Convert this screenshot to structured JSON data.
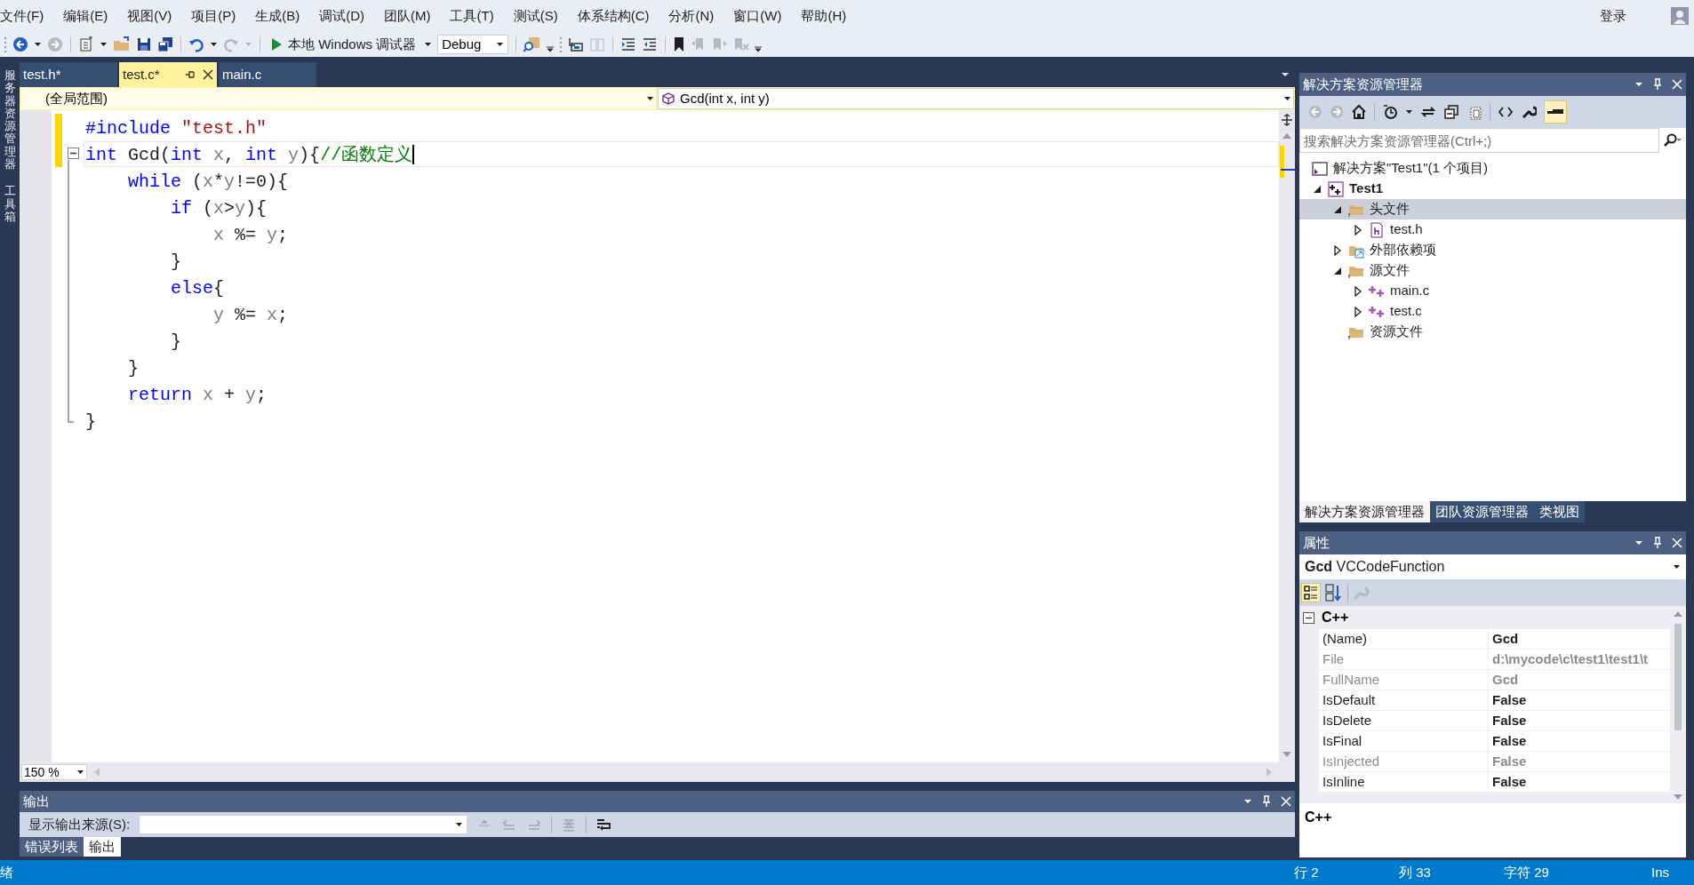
{
  "menu": [
    "文件(F)",
    "编辑(E)",
    "视图(V)",
    "项目(P)",
    "生成(B)",
    "调试(D)",
    "团队(M)",
    "工具(T)",
    "测试(S)",
    "体系结构(C)",
    "分析(N)",
    "窗口(W)",
    "帮助(H)"
  ],
  "login": "登录",
  "toolbar": {
    "debugger": "本地 Windows 调试器",
    "configuration": "Debug"
  },
  "left_rail": [
    "服务器资源管理器",
    "工具箱"
  ],
  "editor": {
    "tabs": [
      {
        "label": "test.h*",
        "selected": false
      },
      {
        "label": "test.c*",
        "selected": true
      },
      {
        "label": "main.c",
        "selected": false
      }
    ],
    "scope": "(全局范围)",
    "member": "Gcd(int x, int y)",
    "lines": [
      {
        "modified": true,
        "current": false,
        "collapsible": false,
        "tokens": [
          {
            "kind": "preproc",
            "text": "#include"
          },
          {
            "kind": "string",
            "text": " \"test.h\""
          }
        ]
      },
      {
        "modified": true,
        "current": true,
        "collapsible": true,
        "tokens": [
          {
            "kind": "keyword",
            "text": "int"
          },
          {
            "kind": "plain",
            "text": " Gcd("
          },
          {
            "kind": "keyword",
            "text": "int"
          },
          {
            "kind": "var",
            "text": " x"
          },
          {
            "kind": "plain",
            "text": ", "
          },
          {
            "kind": "keyword",
            "text": "int"
          },
          {
            "kind": "var",
            "text": " y"
          },
          {
            "kind": "plain",
            "text": "){"
          },
          {
            "kind": "comment",
            "text": "//函数定义"
          }
        ]
      },
      {
        "modified": false,
        "current": false,
        "collapsible": false,
        "tokens": [
          {
            "kind": "keyword",
            "text": "    while"
          },
          {
            "kind": "plain",
            "text": " ("
          },
          {
            "kind": "var",
            "text": "x"
          },
          {
            "kind": "plain",
            "text": "*"
          },
          {
            "kind": "var",
            "text": "y"
          },
          {
            "kind": "plain",
            "text": "!=0){"
          }
        ]
      },
      {
        "modified": false,
        "current": false,
        "collapsible": false,
        "tokens": [
          {
            "kind": "keyword",
            "text": "        if"
          },
          {
            "kind": "plain",
            "text": " ("
          },
          {
            "kind": "var",
            "text": "x"
          },
          {
            "kind": "plain",
            "text": ">"
          },
          {
            "kind": "var",
            "text": "y"
          },
          {
            "kind": "plain",
            "text": "){"
          }
        ]
      },
      {
        "modified": false,
        "current": false,
        "collapsible": false,
        "tokens": [
          {
            "kind": "var",
            "text": "            x"
          },
          {
            "kind": "plain",
            "text": " %= "
          },
          {
            "kind": "var",
            "text": "y"
          },
          {
            "kind": "plain",
            "text": ";"
          }
        ]
      },
      {
        "modified": false,
        "current": false,
        "collapsible": false,
        "tokens": [
          {
            "kind": "plain",
            "text": "        }"
          }
        ]
      },
      {
        "modified": false,
        "current": false,
        "collapsible": false,
        "tokens": [
          {
            "kind": "keyword",
            "text": "        else"
          },
          {
            "kind": "plain",
            "text": "{"
          }
        ]
      },
      {
        "modified": false,
        "current": false,
        "collapsible": false,
        "tokens": [
          {
            "kind": "var",
            "text": "            y"
          },
          {
            "kind": "plain",
            "text": " %= "
          },
          {
            "kind": "var",
            "text": "x"
          },
          {
            "kind": "plain",
            "text": ";"
          }
        ]
      },
      {
        "modified": false,
        "current": false,
        "collapsible": false,
        "tokens": [
          {
            "kind": "plain",
            "text": "        }"
          }
        ]
      },
      {
        "modified": false,
        "current": false,
        "collapsible": false,
        "tokens": [
          {
            "kind": "plain",
            "text": "    }"
          }
        ]
      },
      {
        "modified": false,
        "current": false,
        "collapsible": false,
        "tokens": [
          {
            "kind": "keyword",
            "text": "    return"
          },
          {
            "kind": "var",
            "text": " x"
          },
          {
            "kind": "plain",
            "text": " + "
          },
          {
            "kind": "var",
            "text": "y"
          },
          {
            "kind": "plain",
            "text": ";"
          }
        ]
      },
      {
        "modified": false,
        "current": false,
        "collapsible": false,
        "tokens": [
          {
            "kind": "plain",
            "text": "}"
          }
        ]
      }
    ],
    "zoom": "150 %"
  },
  "output": {
    "title": "输出",
    "source_label": "显示输出来源(S):",
    "tabs": [
      {
        "label": "错误列表",
        "selected": false
      },
      {
        "label": "输出",
        "selected": true
      }
    ]
  },
  "solution_explorer": {
    "title": "解决方案资源管理器",
    "search_placeholder": "搜索解决方案资源管理器(Ctrl+;)",
    "tree": [
      {
        "kind": "solution",
        "label": "解决方案\"Test1\"(1 个项目)",
        "selected": false,
        "children": [
          {
            "kind": "project",
            "label": "Test1",
            "expanded": true,
            "selected": false,
            "children": [
              {
                "kind": "folder",
                "label": "头文件",
                "expanded": true,
                "selected": true,
                "children": [
                  {
                    "kind": "header",
                    "label": "test.h",
                    "expanded": false,
                    "selected": false
                  }
                ]
              },
              {
                "kind": "deps",
                "label": "外部依赖项",
                "expanded": false,
                "selected": false
              },
              {
                "kind": "folder",
                "label": "源文件",
                "expanded": true,
                "selected": false,
                "children": [
                  {
                    "kind": "source",
                    "label": "main.c",
                    "expanded": false,
                    "selected": false
                  },
                  {
                    "kind": "source",
                    "label": "test.c",
                    "expanded": false,
                    "selected": false
                  }
                ]
              },
              {
                "kind": "folder",
                "label": "资源文件",
                "selected": false
              }
            ]
          }
        ]
      }
    ],
    "tabs": [
      {
        "label": "解决方案资源管理器",
        "selected": true
      },
      {
        "label": "团队资源管理器",
        "selected": false
      },
      {
        "label": "类视图",
        "selected": false
      }
    ]
  },
  "properties": {
    "title": "属性",
    "object_name": "Gcd",
    "object_type": "VCCodeFunction",
    "category": "C++",
    "rows": [
      {
        "name": "(Name)",
        "value": "Gcd",
        "disabled": false
      },
      {
        "name": "File",
        "value": "d:\\mycode\\c\\test1\\test1\\t",
        "disabled": true
      },
      {
        "name": "FullName",
        "value": "Gcd",
        "disabled": true
      },
      {
        "name": "IsDefault",
        "value": "False",
        "disabled": false
      },
      {
        "name": "IsDelete",
        "value": "False",
        "disabled": false
      },
      {
        "name": "IsFinal",
        "value": "False",
        "disabled": false
      },
      {
        "name": "IsInjected",
        "value": "False",
        "disabled": true
      },
      {
        "name": "IsInline",
        "value": "False",
        "disabled": false
      }
    ],
    "description": "C++"
  },
  "status_bar": {
    "message": "绪",
    "line": "行 2",
    "column": "列 33",
    "character": "字符 29",
    "mode": "Ins"
  }
}
